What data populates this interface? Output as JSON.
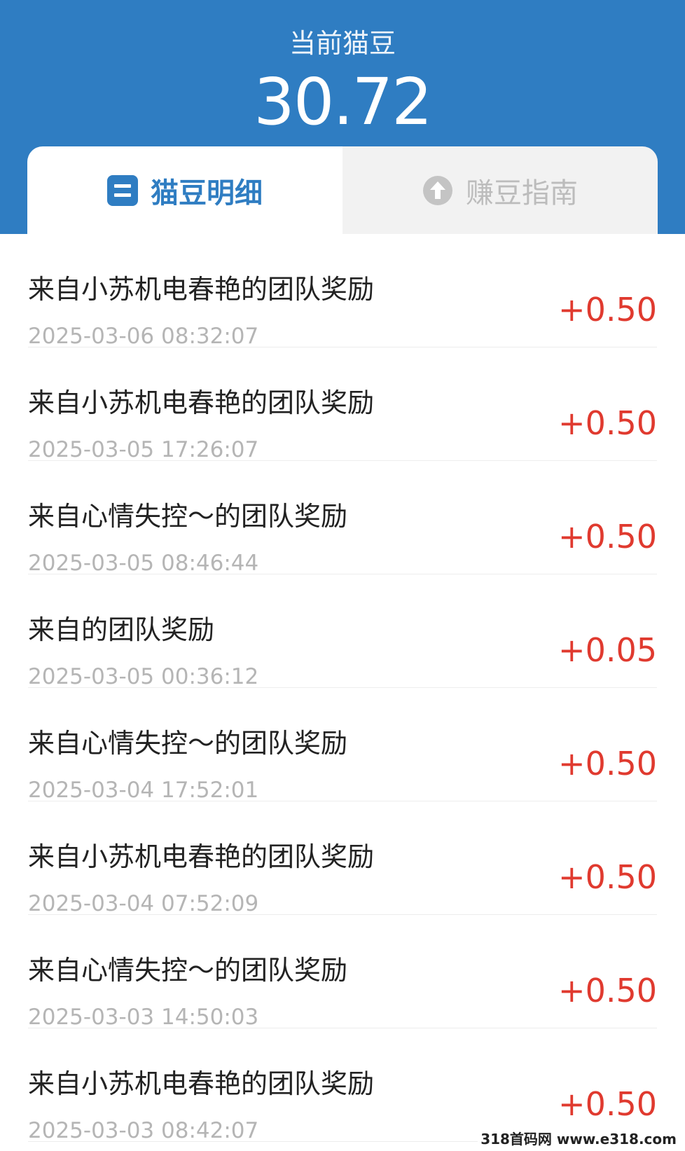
{
  "header": {
    "balance_label": "当前猫豆",
    "balance_value": "30.72"
  },
  "tabs": [
    {
      "label": "猫豆明细",
      "active": true,
      "icon": "list-icon"
    },
    {
      "label": "赚豆指南",
      "active": false,
      "icon": "arrow-up-circle-icon"
    }
  ],
  "records": [
    {
      "title": "来自小苏机电春艳的团队奖励",
      "time": "2025-03-06 08:32:07",
      "amount": "+0.50"
    },
    {
      "title": "来自小苏机电春艳的团队奖励",
      "time": "2025-03-05 17:26:07",
      "amount": "+0.50"
    },
    {
      "title": "来自心情失控～的团队奖励",
      "time": "2025-03-05 08:46:44",
      "amount": "+0.50"
    },
    {
      "title": "来自的团队奖励",
      "time": "2025-03-05 00:36:12",
      "amount": "+0.05"
    },
    {
      "title": "来自心情失控～的团队奖励",
      "time": "2025-03-04 17:52:01",
      "amount": "+0.50"
    },
    {
      "title": "来自小苏机电春艳的团队奖励",
      "time": "2025-03-04 07:52:09",
      "amount": "+0.50"
    },
    {
      "title": "来自心情失控～的团队奖励",
      "time": "2025-03-03 14:50:03",
      "amount": "+0.50"
    },
    {
      "title": "来自小苏机电春艳的团队奖励",
      "time": "2025-03-03 08:42:07",
      "amount": "+0.50"
    }
  ],
  "watermark": "318首码网 www.e318.com",
  "colors": {
    "header_bg": "#2f7dc2",
    "accent": "#2f7dc2",
    "amount": "#e03a2f",
    "time": "#b5b5b5",
    "tab_inactive_bg": "#f2f2f2"
  }
}
